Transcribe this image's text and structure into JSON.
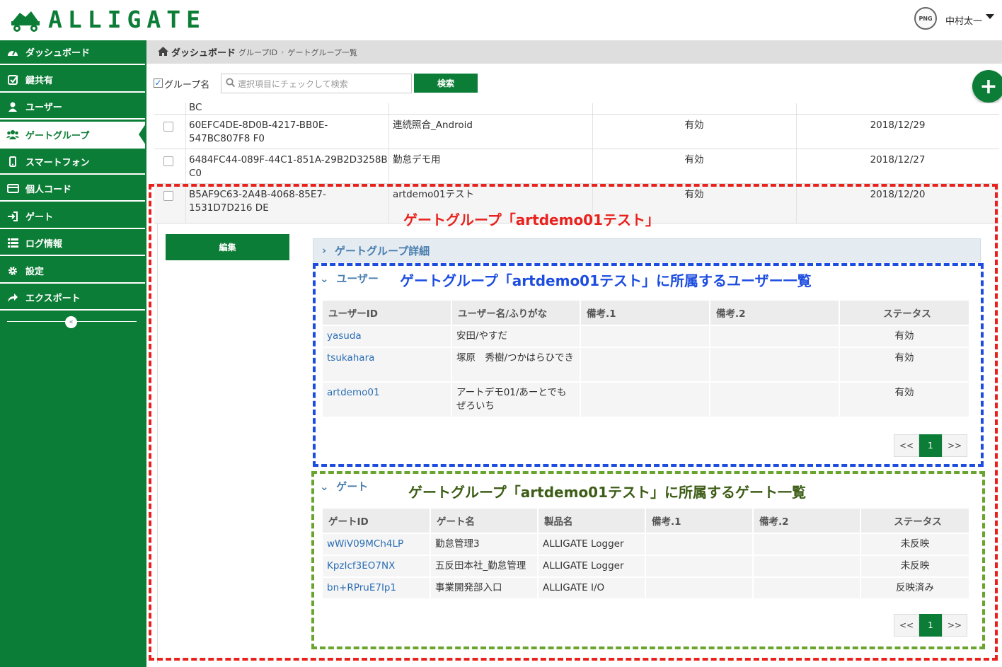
{
  "header": {
    "logo_text": "ALLIGATE",
    "avatar_label": "PNG",
    "user_name": "中村太一"
  },
  "sidebar": {
    "items": [
      {
        "label": "ダッシュボード",
        "icon": "dashboard-icon"
      },
      {
        "label": "鍵共有",
        "icon": "check-square-icon"
      },
      {
        "label": "ユーザー",
        "icon": "user-icon"
      },
      {
        "label": "ゲートグループ",
        "icon": "users-icon",
        "active": true
      },
      {
        "label": "スマートフォン",
        "icon": "smartphone-icon"
      },
      {
        "label": "個人コード",
        "icon": "card-icon"
      },
      {
        "label": "ゲート",
        "icon": "sign-in-icon"
      },
      {
        "label": "ログ情報",
        "icon": "list-icon"
      },
      {
        "label": "設定",
        "icon": "gear-icon"
      },
      {
        "label": "エクスポート",
        "icon": "share-icon"
      }
    ],
    "collapse_symbol": "«"
  },
  "breadcrumb": {
    "home": "ダッシュボード",
    "items": [
      "グループID",
      "ゲートグループ一覧"
    ],
    "separator": "›"
  },
  "search": {
    "checkbox_label": "グループ名",
    "placeholder": "選択項目にチェックして検索",
    "button_label": "検索"
  },
  "add_button_symbol": "+",
  "group_rows": [
    {
      "id": "BC",
      "name": "",
      "status": "",
      "date": ""
    },
    {
      "id": "60EFC4DE-8D0B-4217-BB0E-547BC807F8 F0",
      "name": "連続照合_Android",
      "status": "有効",
      "date": "2018/12/29"
    },
    {
      "id": "6484FC44-089F-44C1-851A-29B2D3258B C0",
      "name": "勤怠デモ用",
      "status": "有効",
      "date": "2018/12/27"
    },
    {
      "id": "B5AF9C63-2A4B-4068-85E7-1531D7D216 DE",
      "name": "artdemo01テスト",
      "status": "有効",
      "date": "2018/12/20"
    }
  ],
  "detail": {
    "edit_button": "編集",
    "detail_section": "ゲートグループ詳細",
    "users_section": "ユーザー",
    "gates_section": "ゲート",
    "users_table": {
      "headers": [
        "ユーザーID",
        "ユーザー名/ふりがな",
        "備考.1",
        "備考.2",
        "ステータス"
      ],
      "rows": [
        [
          "yasuda",
          "安田/やすだ",
          "",
          "",
          "有効"
        ],
        [
          "tsukahara",
          "塚原　秀樹/つかはらひでき",
          "",
          "",
          "有効"
        ],
        [
          "artdemo01",
          "アートデモ01/あーとでもぜろいち",
          "",
          "",
          "有効"
        ]
      ]
    },
    "gates_table": {
      "headers": [
        "ゲートID",
        "ゲート名",
        "製品名",
        "備考.1",
        "備考.2",
        "ステータス"
      ],
      "rows": [
        [
          "wWiV09MCh4LP",
          "勤怠管理3",
          "ALLIGATE Logger",
          "",
          "",
          "未反映"
        ],
        [
          "KpzIcf3EO7NX",
          "五反田本社_勤怠管理",
          "ALLIGATE Logger",
          "",
          "",
          "未反映"
        ],
        [
          "bn+RPruE7Ip1",
          "事業開発部入口",
          "ALLIGATE I/O",
          "",
          "",
          "反映済み"
        ]
      ]
    },
    "pager": {
      "prev": "<<",
      "current": "1",
      "next": ">>"
    }
  },
  "annotations": {
    "red": "ゲートグループ「artdemo01テスト」",
    "blue": "ゲートグループ「artdemo01テスト」に所属するユーザー一覧",
    "green": "ゲートグループ「artdemo01テスト」に所属するゲート一覧"
  },
  "colors": {
    "brand_green": "#0c7d36",
    "annotation_red": "#e8211c",
    "annotation_blue": "#1d4de0",
    "annotation_green": "#69a52e",
    "link_blue": "#2a6db4"
  }
}
